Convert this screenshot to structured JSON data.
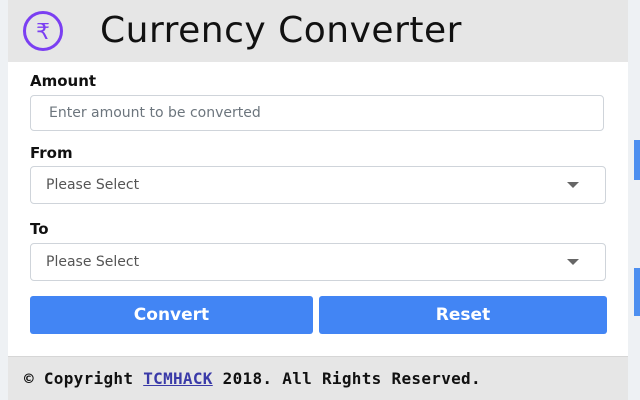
{
  "header": {
    "logo_icon": "rupee-circle-icon",
    "logo_glyph": "₹",
    "title": "Currency Converter"
  },
  "form": {
    "amount": {
      "label": "Amount",
      "value": "",
      "placeholder": "Enter amount to be converted"
    },
    "from": {
      "label": "From",
      "selected": "Please Select"
    },
    "to": {
      "label": "To",
      "selected": "Please Select"
    }
  },
  "buttons": {
    "convert_label": "Convert",
    "reset_label": "Reset"
  },
  "footer": {
    "prefix": "© Copyright ",
    "link_text": "TCMHACK",
    "suffix": " 2018. All Rights Reserved."
  },
  "colors": {
    "accent": "#4285f4",
    "logo_purple": "#7b3ff2",
    "header_bg": "#e6e6e6"
  }
}
